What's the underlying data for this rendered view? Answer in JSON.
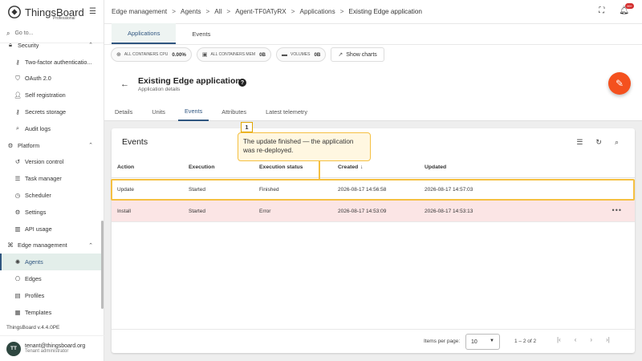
{
  "app": {
    "logo_text": "ThingsBoard",
    "logo_sub": "Professional",
    "goto": "Go to...",
    "version": "ThingsBoard v.4.4.0PE"
  },
  "sidebar": {
    "items": [
      {
        "label": "Security",
        "icon": "lock-icon",
        "group": true
      },
      {
        "label": "Two-factor authenticatio...",
        "icon": "key-icon"
      },
      {
        "label": "OAuth 2.0",
        "icon": "shield-icon"
      },
      {
        "label": "Self registration",
        "icon": "person-add-icon"
      },
      {
        "label": "Secrets storage",
        "icon": "key-icon"
      },
      {
        "label": "Audit logs",
        "icon": "magnify-icon"
      },
      {
        "label": "Platform",
        "icon": "gear-icon",
        "group": true
      },
      {
        "label": "Version control",
        "icon": "history-icon"
      },
      {
        "label": "Task manager",
        "icon": "list-icon"
      },
      {
        "label": "Scheduler",
        "icon": "clock-icon"
      },
      {
        "label": "Settings",
        "icon": "gear-icon"
      },
      {
        "label": "API usage",
        "icon": "chart-icon"
      },
      {
        "label": "Edge management",
        "icon": "edge-icon",
        "group": true
      },
      {
        "label": "Agents",
        "icon": "agent-icon",
        "active": true
      },
      {
        "label": "Edges",
        "icon": "router-icon"
      },
      {
        "label": "Profiles",
        "icon": "profile-icon"
      },
      {
        "label": "Templates",
        "icon": "template-icon"
      }
    ]
  },
  "user": {
    "initials": "TT",
    "email": "tenant@thingsboard.org",
    "role": "Tenant administrator"
  },
  "breadcrumb": [
    "Edge management",
    "Agents",
    "All",
    "Agent-TF0ATyRX",
    "Applications",
    "Existing Edge application"
  ],
  "topbar": {
    "notification_count": "99+"
  },
  "main_tabs": [
    {
      "label": "Applications",
      "active": true
    },
    {
      "label": "Events",
      "active": false
    }
  ],
  "stats": [
    {
      "label": "ALL CONTAINERS CPU",
      "value": "0.00%",
      "icon": "globe-icon"
    },
    {
      "label": "ALL CONTAINERS MEM",
      "value": "0B",
      "icon": "memory-icon"
    },
    {
      "label": "VOLUMES",
      "value": "0B",
      "icon": "folder-icon"
    }
  ],
  "show_charts": "Show charts",
  "details": {
    "title": "Existing Edge application",
    "subtitle": "Application details",
    "help": "?"
  },
  "detail_tabs": [
    {
      "label": "Details"
    },
    {
      "label": "Units"
    },
    {
      "label": "Events",
      "active": true
    },
    {
      "label": "Attributes"
    },
    {
      "label": "Latest telemetry"
    }
  ],
  "events": {
    "title": "Events",
    "columns": [
      "Action",
      "Execution",
      "Execution status",
      "Created",
      "Updated"
    ],
    "rows": [
      {
        "action": "Update",
        "execution": "Started",
        "status": "Finished",
        "created": "2026-08-17 14:56:58",
        "updated": "2026-08-17 14:57:03",
        "error": false
      },
      {
        "action": "Install",
        "execution": "Started",
        "status": "Error",
        "created": "2026-08-17 14:53:09",
        "updated": "2026-08-17 14:53:13",
        "error": true
      }
    ],
    "items_per_page_label": "Items per page:",
    "items_per_page": "10",
    "range": "1 – 2 of 2"
  },
  "callout": {
    "number": "1",
    "text": "The update finished — the application was re-deployed."
  },
  "colors": {
    "primary": "#305680",
    "fab": "#f4511e",
    "highlight": "#f5c042",
    "error_row": "#fbe5e5"
  }
}
